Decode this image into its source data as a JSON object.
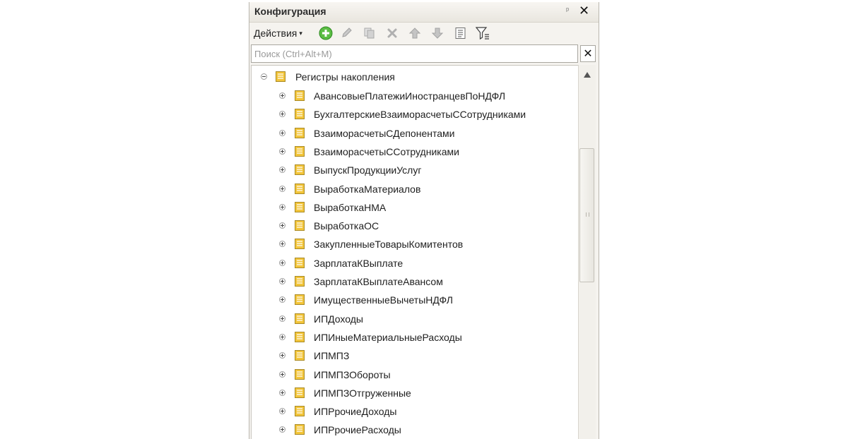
{
  "panel": {
    "title": "Конфигурация",
    "pin_glyph": "ᵖ",
    "close_glyph": "✕"
  },
  "toolbar": {
    "actions_label": "Действия",
    "actions_caret": "▾",
    "icons": [
      "add-icon",
      "edit-icon",
      "copy-icon",
      "delete-icon",
      "move-up-icon",
      "move-down-icon",
      "list-icon",
      "filter-icon"
    ]
  },
  "search": {
    "placeholder": "Поиск (Ctrl+Alt+M)",
    "value": "",
    "clear_glyph": "✕"
  },
  "tree": {
    "root": {
      "label": "Регистры накопления",
      "expanded": true
    },
    "items": [
      "АвансовыеПлатежиИностранцевПоНДФЛ",
      "БухгалтерскиеВзаиморасчетыССотрудниками",
      "ВзаиморасчетыСДепонентами",
      "ВзаиморасчетыССотрудниками",
      "ВыпускПродукцииУслуг",
      "ВыработкаМатериалов",
      "ВыработкаНМА",
      "ВыработкаОС",
      "ЗакупленныеТоварыКомитентов",
      "ЗарплатаКВыплате",
      "ЗарплатаКВыплатеАвансом",
      "ИмущественныеВычетыНДФЛ",
      "ИПДоходы",
      "ИПИныеМатериальныеРасходы",
      "ИПМПЗ",
      "ИПМПЗОбороты",
      "ИПМПЗОтгруженные",
      "ИПРрочиеДоходы",
      "ИПРрочиеРасходы"
    ]
  },
  "colors": {
    "panel_bg": "#f5f3ef",
    "add_green": "#4caf3a",
    "icon_gray": "#b5b5b5",
    "node_yellow": "#f2c12e"
  }
}
